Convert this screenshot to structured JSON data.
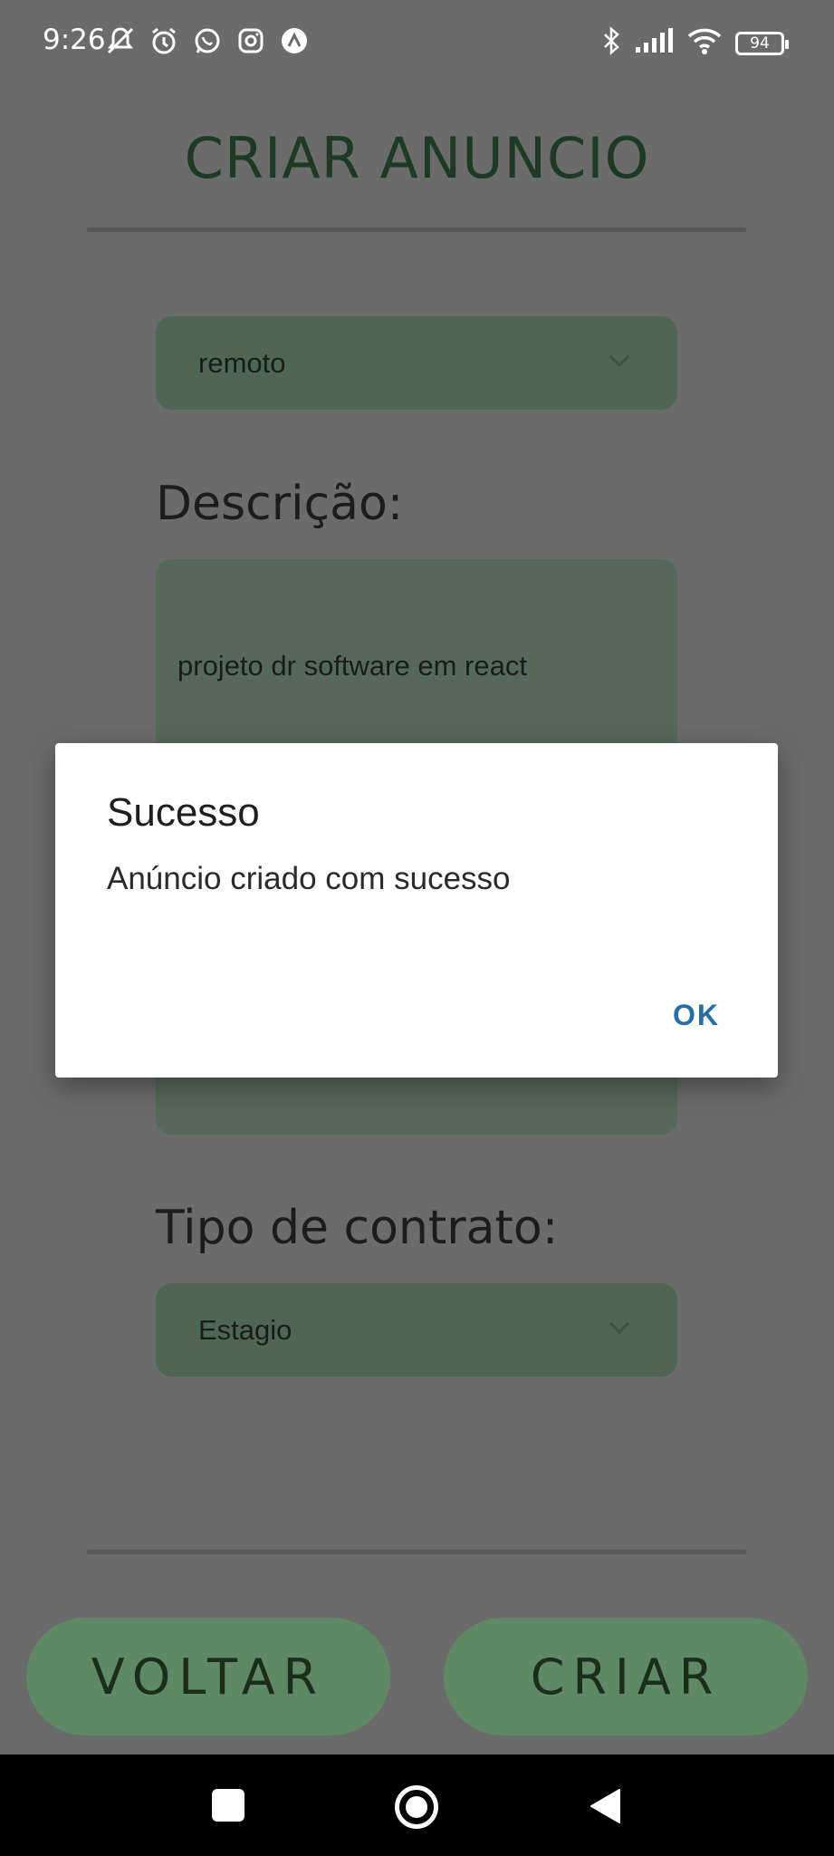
{
  "status_bar": {
    "time": "9:26",
    "battery": "94",
    "left_icons": [
      "muted-bell-icon",
      "alarm-icon",
      "whatsapp-icon",
      "instagram-icon",
      "app-icon"
    ],
    "right_icons": [
      "bluetooth-icon",
      "signal-icon",
      "wifi-icon",
      "battery-icon"
    ]
  },
  "page": {
    "title": "CRIAR ANUNCIO",
    "modality_select": {
      "value": "remoto"
    },
    "description_label": "Descrição:",
    "description_value": "projeto dr software em react",
    "contract_label": "Tipo de contrato:",
    "contract_select": {
      "value": "Estagio"
    },
    "back_button": "VOLTAR",
    "create_button": "CRIAR"
  },
  "dialog": {
    "title": "Sucesso",
    "message": "Anúncio criado com sucesso",
    "ok_label": "OK"
  },
  "colors": {
    "overlay_background": "#6b6b6b",
    "field_green": "#4e6653",
    "button_green": "#5f8865",
    "title_green": "#1f3a24",
    "dialog_button_blue": "#2a6fa3"
  }
}
